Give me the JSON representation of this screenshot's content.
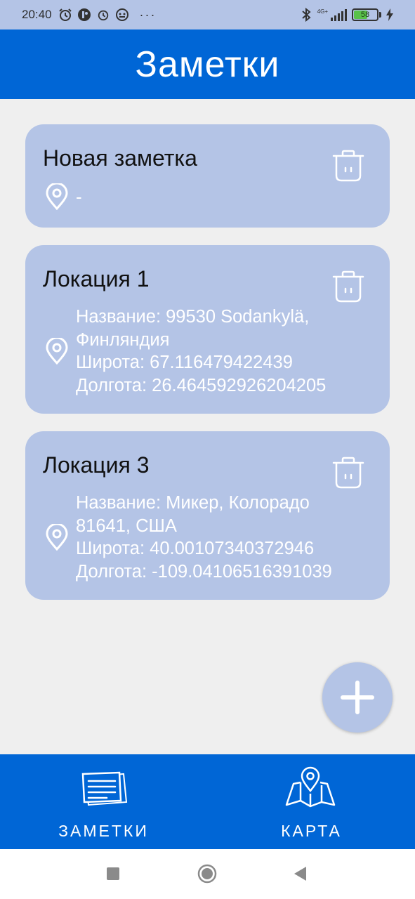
{
  "status_bar": {
    "time": "20:40",
    "dots": "···",
    "network": "4G+",
    "battery": "58"
  },
  "app_bar": {
    "title": "Заметки"
  },
  "notes": [
    {
      "title": "Новая заметка",
      "location": "-"
    },
    {
      "title": "Локация 1",
      "lines": [
        "Название: 99530 Sodankylä,",
        "Финляндия",
        "Широта: 67.116479422439",
        "Долгота: 26.464592926204205"
      ]
    },
    {
      "title": "Локация 3",
      "lines": [
        "Название: Микер, Колорадо",
        "81641, США",
        "Широта: 40.00107340372946",
        "Долгота: -109.04106516391039"
      ]
    }
  ],
  "bottom_nav": {
    "notes_label": "ЗАМЕТКИ",
    "map_label": "КАРТА"
  },
  "colors": {
    "primary": "#0066d6",
    "card": "#b4c4e6",
    "background": "#efefef"
  },
  "icons": {
    "delete": "trash-icon",
    "location": "map-pin-icon",
    "add": "plus-icon",
    "notes_tab": "notes-icon",
    "map_tab": "map-icon"
  }
}
